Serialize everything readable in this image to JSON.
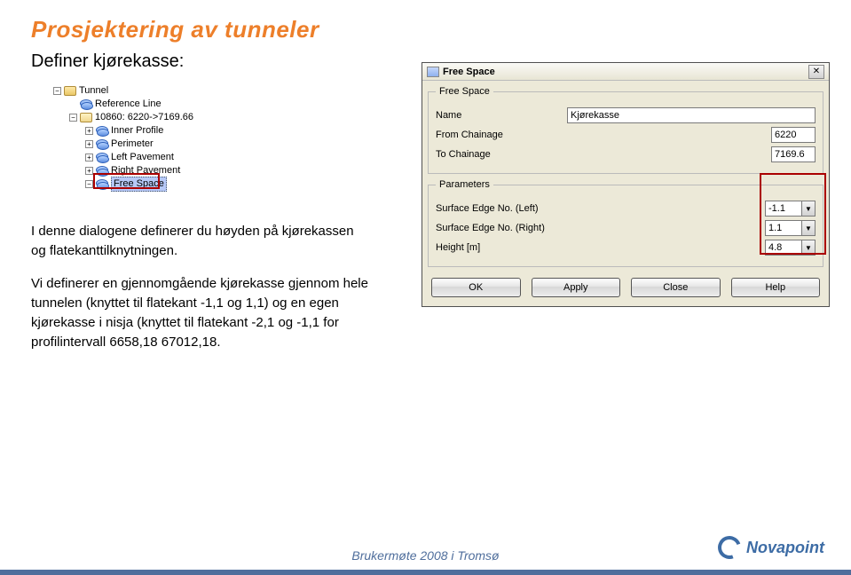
{
  "page": {
    "title": "Prosjektering av tunneler",
    "subhead": "Definer kjørekasse:",
    "body_p1": "I denne dialogene definerer du høyden på kjørekassen og flatekanttilknytningen.",
    "body_p2": "Vi definerer en gjennomgående kjørekasse gjennom hele tunnelen (knyttet til flatekant -1,1 og 1,1) og en egen kjørekasse i nisja (knyttet til flatekant -2,1 og -1,1 for profilintervall 6658,18 67012,18."
  },
  "tree": {
    "items": [
      {
        "level": 1,
        "exp": "-",
        "icon": "folder",
        "label": "Tunnel"
      },
      {
        "level": 2,
        "exp": "",
        "icon": "layer",
        "label": "Reference Line"
      },
      {
        "level": 2,
        "exp": "-",
        "icon": "folder-open",
        "label": "10860: 6220->7169.66"
      },
      {
        "level": 3,
        "exp": "+",
        "icon": "layer",
        "label": "Inner Profile"
      },
      {
        "level": 3,
        "exp": "+",
        "icon": "layer",
        "label": "Perimeter"
      },
      {
        "level": 3,
        "exp": "+",
        "icon": "layer",
        "label": "Left Pavement"
      },
      {
        "level": 3,
        "exp": "+",
        "icon": "layer",
        "label": "Right Pavement"
      },
      {
        "level": 3,
        "exp": "-",
        "icon": "layer",
        "label": "Free Space",
        "selected": true
      }
    ]
  },
  "dialog": {
    "title": "Free Space",
    "group1": {
      "legend": "Free Space",
      "name_label": "Name",
      "name_value": "Kjørekasse",
      "from_label": "From Chainage",
      "from_value": "6220",
      "to_label": "To Chainage",
      "to_value": "7169.6"
    },
    "group2": {
      "legend": "Parameters",
      "left_label": "Surface Edge No. (Left)",
      "left_value": "-1.1",
      "right_label": "Surface Edge No. (Right)",
      "right_value": "1.1",
      "height_label": "Height [m]",
      "height_value": "4.8"
    },
    "buttons": {
      "ok": "OK",
      "apply": "Apply",
      "close": "Close",
      "help": "Help"
    }
  },
  "footer": {
    "text": "Brukermøte 2008 i Tromsø",
    "brand": "Novapoint"
  }
}
